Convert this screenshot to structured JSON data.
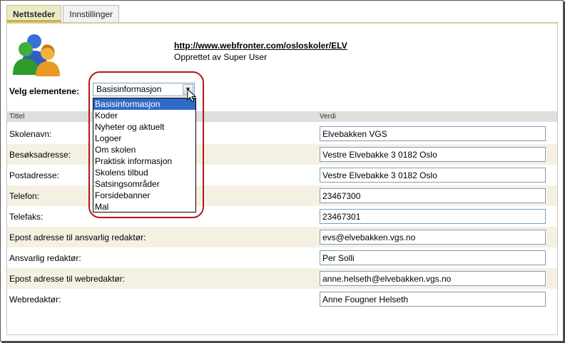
{
  "tabs": [
    {
      "label": "Nettsteder",
      "active": true
    },
    {
      "label": "Innstillinger",
      "active": false
    }
  ],
  "site": {
    "url": "http://www.webfronter.com/osloskoler/ELV",
    "created_by": "Opprettet av Super User"
  },
  "selector": {
    "label": "Velg elementene:",
    "selected": "Basisinformasjon",
    "options": [
      "Basisinformasjon",
      "Koder",
      "Nyheter og aktuelt",
      "Logoer",
      "Om skolen",
      "Praktisk informasjon",
      "Skolens tilbud",
      "Satsingsområder",
      "Forsidebanner",
      "Mal"
    ]
  },
  "table": {
    "header_title": "Tittel",
    "header_value": "Verdi",
    "rows": [
      {
        "label": "Skolenavn:",
        "value": "Elvebakken VGS"
      },
      {
        "label": "Besøksadresse:",
        "value": "Vestre Elvebakke 3 0182 Oslo"
      },
      {
        "label": "Postadresse:",
        "value": "Vestre Elvebakke 3 0182 Oslo"
      },
      {
        "label": "Telefon:",
        "value": "23467300"
      },
      {
        "label": "Telefaks:",
        "value": "23467301"
      },
      {
        "label": "Epost adresse til ansvarlig redaktør:",
        "value": "evs@elvebakken.vgs.no"
      },
      {
        "label": "Ansvarlig redaktør:",
        "value": "Per Solli"
      },
      {
        "label": "Epost adresse til webredaktør:",
        "value": "anne.helseth@elvebakken.vgs.no"
      },
      {
        "label": "Webredaktør:",
        "value": "Anne Fougner Helseth"
      }
    ]
  },
  "icons": {
    "logo": "users-group-icon",
    "select_arrow": "chevron-down-icon",
    "cursor": "mouse-pointer-icon"
  },
  "colors": {
    "active_tab_bg": "#eceac6",
    "highlight_ring": "#b01818",
    "dropdown_selected": "#316ac5",
    "alt_row": "#f5f1e2"
  }
}
